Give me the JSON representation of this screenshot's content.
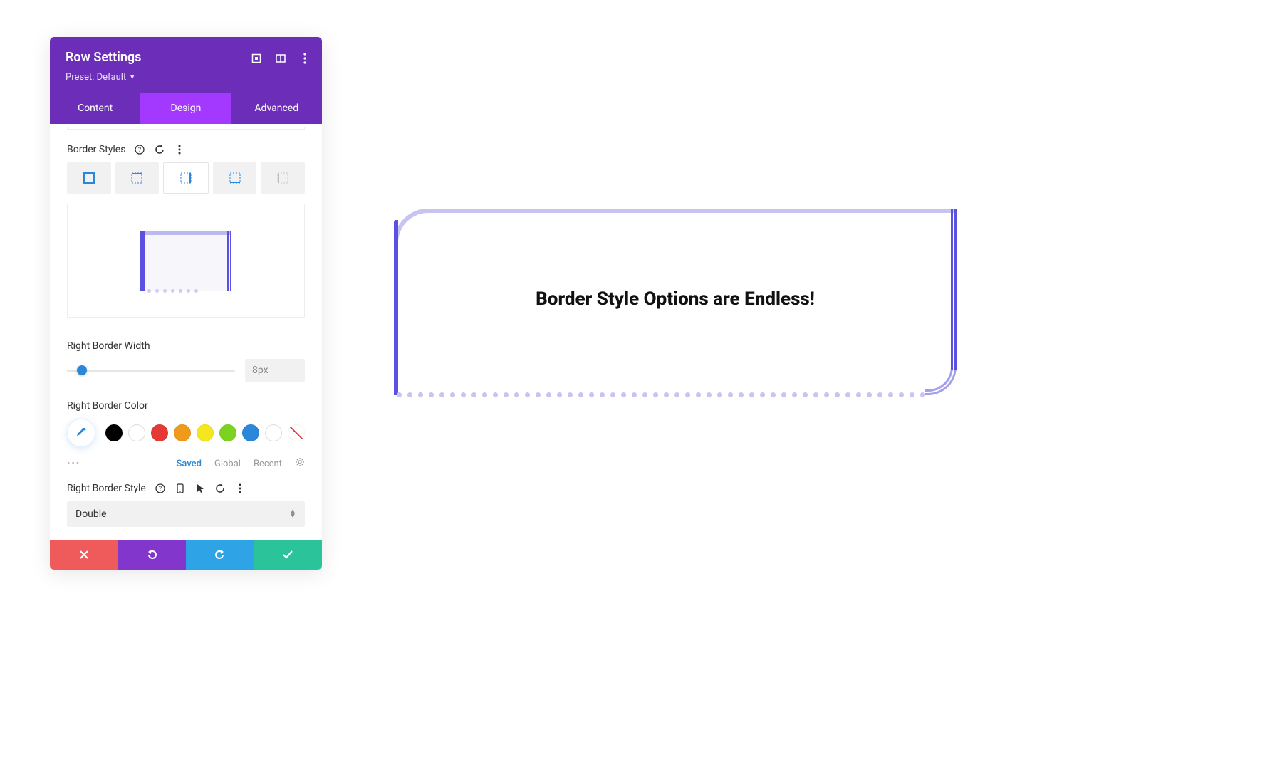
{
  "panel": {
    "title": "Row Settings",
    "preset_label": "Preset: Default"
  },
  "tabs": {
    "content": "Content",
    "design": "Design",
    "advanced": "Advanced"
  },
  "section": {
    "border_styles_label": "Border Styles"
  },
  "right_border_width": {
    "label": "Right Border Width",
    "value": "8px"
  },
  "right_border_color": {
    "label": "Right Border Color"
  },
  "color_palette": {
    "colors": [
      "#000000",
      "#ffffff",
      "#e53935",
      "#f09a1a",
      "#f4e71e",
      "#7bd220",
      "#2b87da",
      "#ffffff"
    ]
  },
  "color_tabs": {
    "saved": "Saved",
    "global": "Global",
    "recent": "Recent"
  },
  "right_border_style": {
    "label": "Right Border Style",
    "value": "Double"
  },
  "preview": {
    "caption": "Border Style Options are Endless!"
  },
  "accent": {
    "border_primary": "#5a51e0",
    "border_light": "#c7c4f1"
  }
}
